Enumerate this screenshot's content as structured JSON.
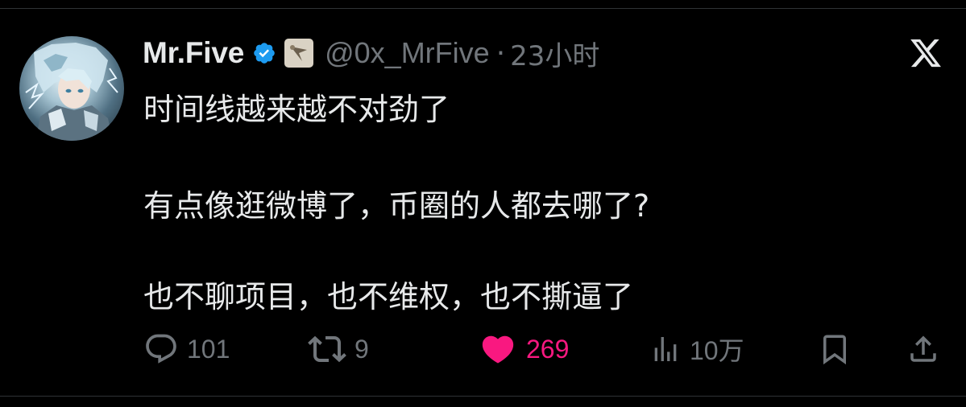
{
  "tweet": {
    "author_name": "Mr.Five",
    "handle": "@0x_MrFive",
    "separator": "·",
    "time": "23小时",
    "lines": [
      "时间线越来越不对劲了",
      "有点像逛微博了，币圈的人都去哪了?",
      "也不聊项目，也不维权，也不撕逼了"
    ]
  },
  "actions": {
    "replies": "101",
    "retweets": "9",
    "likes": "269",
    "views": "10万"
  },
  "icons": {
    "verified": "verified-badge-icon",
    "affiliate": "affiliate-badge-icon",
    "logo": "x-logo-icon",
    "reply": "reply-icon",
    "retweet": "retweet-icon",
    "like": "heart-icon",
    "views": "views-icon",
    "bookmark": "bookmark-icon",
    "share": "share-icon"
  },
  "colors": {
    "background": "#000000",
    "text": "#e7e9ea",
    "muted": "#71767b",
    "like": "#f91880",
    "verified": "#1d9bf0"
  }
}
